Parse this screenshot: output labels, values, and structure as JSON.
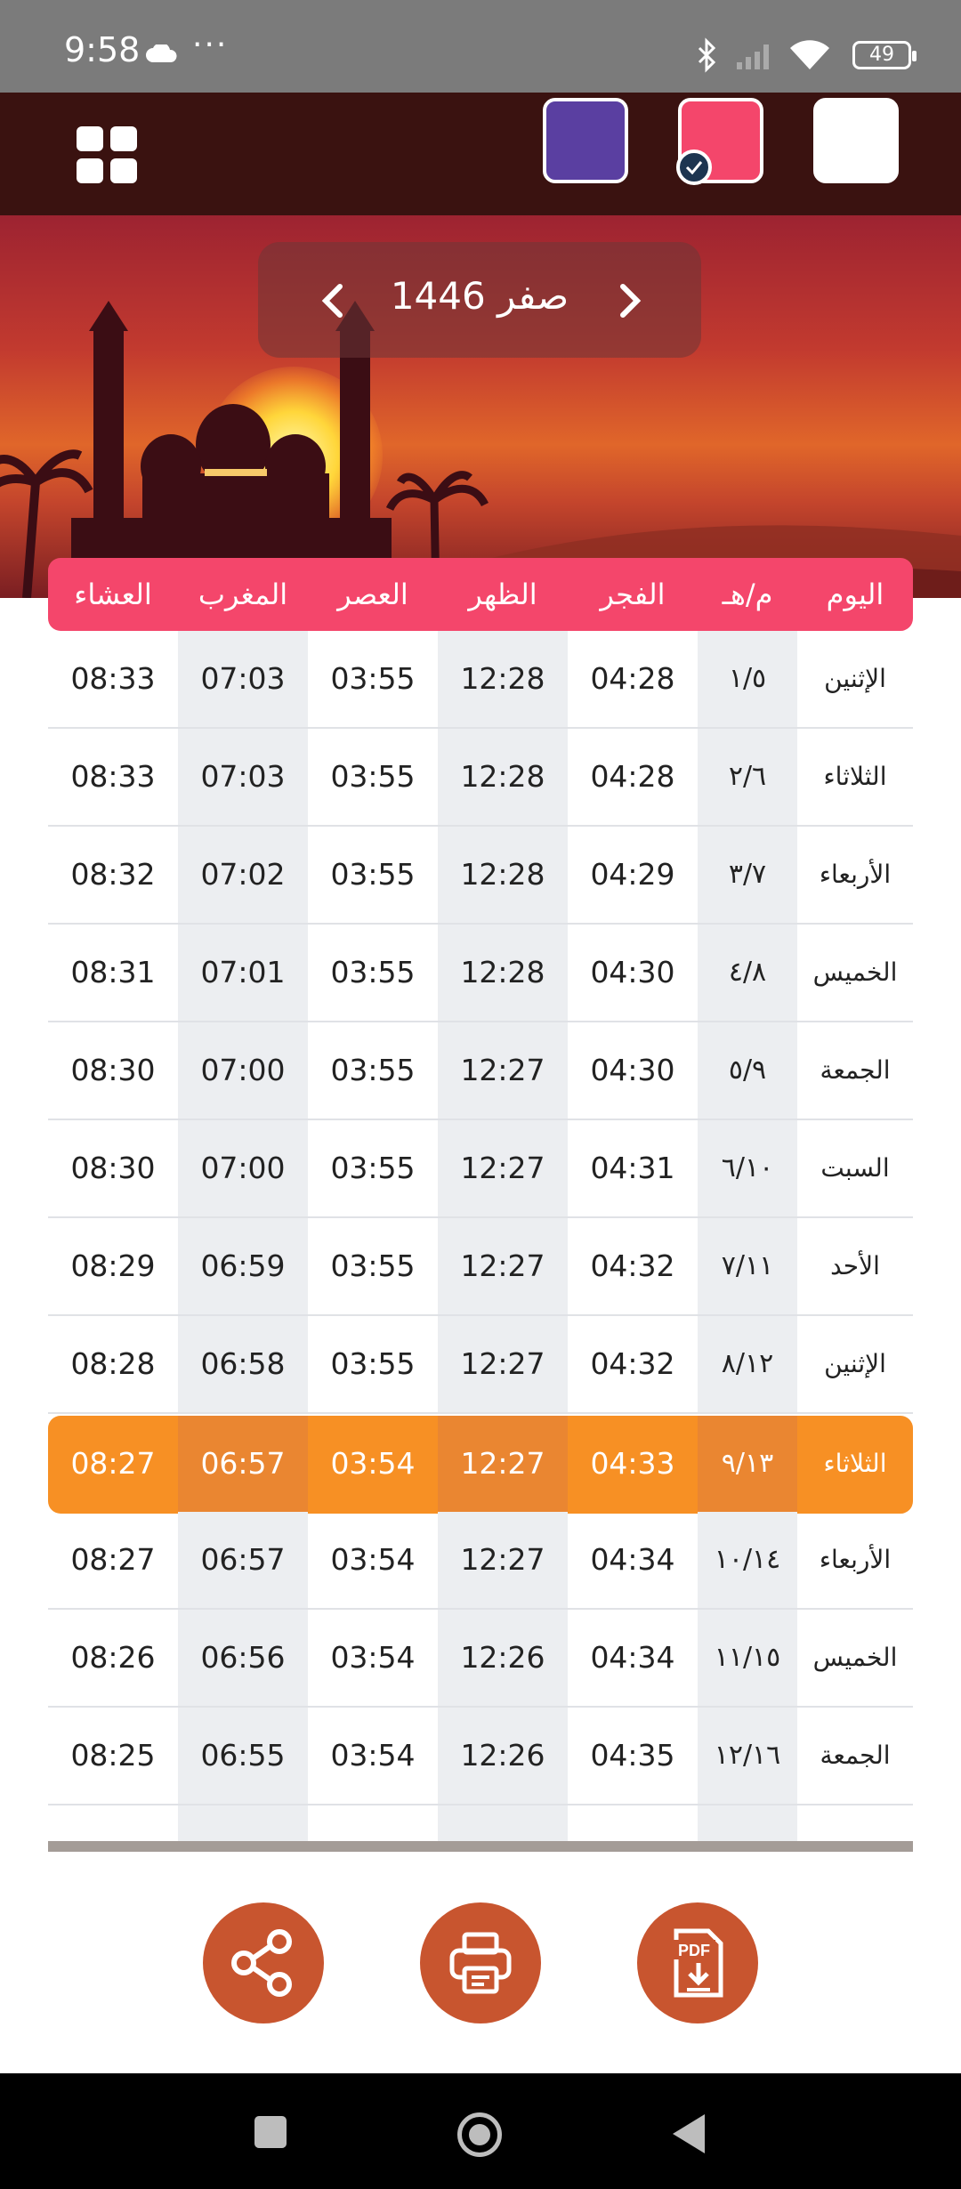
{
  "status_bar": {
    "time": "9:58",
    "dots": "···",
    "battery": "49"
  },
  "toolbar": {
    "menu_icon": "grid-icon",
    "themes": [
      {
        "name": "purple",
        "color": "#5a3fa1"
      },
      {
        "name": "pink",
        "color": "#f4466b",
        "selected": true
      },
      {
        "name": "white",
        "color": "#ffffff"
      }
    ]
  },
  "header": {
    "month_label": "صفر 1446"
  },
  "table": {
    "headers": {
      "day": "اليوم",
      "date": "م/هـ",
      "fajr": "الفجر",
      "dhuhr": "الظهر",
      "asr": "العصر",
      "maghrib": "المغرب",
      "isha": "العشاء"
    },
    "rows": [
      {
        "day": "الإثنين",
        "date": "١/٥",
        "fajr": "04:28",
        "dhuhr": "12:28",
        "asr": "03:55",
        "maghrib": "07:03",
        "isha": "08:33"
      },
      {
        "day": "الثلاثاء",
        "date": "٢/٦",
        "fajr": "04:28",
        "dhuhr": "12:28",
        "asr": "03:55",
        "maghrib": "07:03",
        "isha": "08:33"
      },
      {
        "day": "الأربعاء",
        "date": "٣/٧",
        "fajr": "04:29",
        "dhuhr": "12:28",
        "asr": "03:55",
        "maghrib": "07:02",
        "isha": "08:32"
      },
      {
        "day": "الخميس",
        "date": "٤/٨",
        "fajr": "04:30",
        "dhuhr": "12:28",
        "asr": "03:55",
        "maghrib": "07:01",
        "isha": "08:31"
      },
      {
        "day": "الجمعة",
        "date": "٥/٩",
        "fajr": "04:30",
        "dhuhr": "12:27",
        "asr": "03:55",
        "maghrib": "07:00",
        "isha": "08:30"
      },
      {
        "day": "السبت",
        "date": "٦/١٠",
        "fajr": "04:31",
        "dhuhr": "12:27",
        "asr": "03:55",
        "maghrib": "07:00",
        "isha": "08:30"
      },
      {
        "day": "الأحد",
        "date": "٧/١١",
        "fajr": "04:32",
        "dhuhr": "12:27",
        "asr": "03:55",
        "maghrib": "06:59",
        "isha": "08:29"
      },
      {
        "day": "الإثنين",
        "date": "٨/١٢",
        "fajr": "04:32",
        "dhuhr": "12:27",
        "asr": "03:55",
        "maghrib": "06:58",
        "isha": "08:28"
      },
      {
        "day": "الثلاثاء",
        "date": "٩/١٣",
        "fajr": "04:33",
        "dhuhr": "12:27",
        "asr": "03:54",
        "maghrib": "06:57",
        "isha": "08:27",
        "today": true
      },
      {
        "day": "الأربعاء",
        "date": "١٠/١٤",
        "fajr": "04:34",
        "dhuhr": "12:27",
        "asr": "03:54",
        "maghrib": "06:57",
        "isha": "08:27"
      },
      {
        "day": "الخميس",
        "date": "١١/١٥",
        "fajr": "04:34",
        "dhuhr": "12:26",
        "asr": "03:54",
        "maghrib": "06:56",
        "isha": "08:26"
      },
      {
        "day": "الجمعة",
        "date": "١٢/١٦",
        "fajr": "04:35",
        "dhuhr": "12:26",
        "asr": "03:54",
        "maghrib": "06:55",
        "isha": "08:25"
      }
    ]
  },
  "actions": {
    "share_icon": "share-icon",
    "print_icon": "printer-icon",
    "pdf_label": "PDF"
  }
}
